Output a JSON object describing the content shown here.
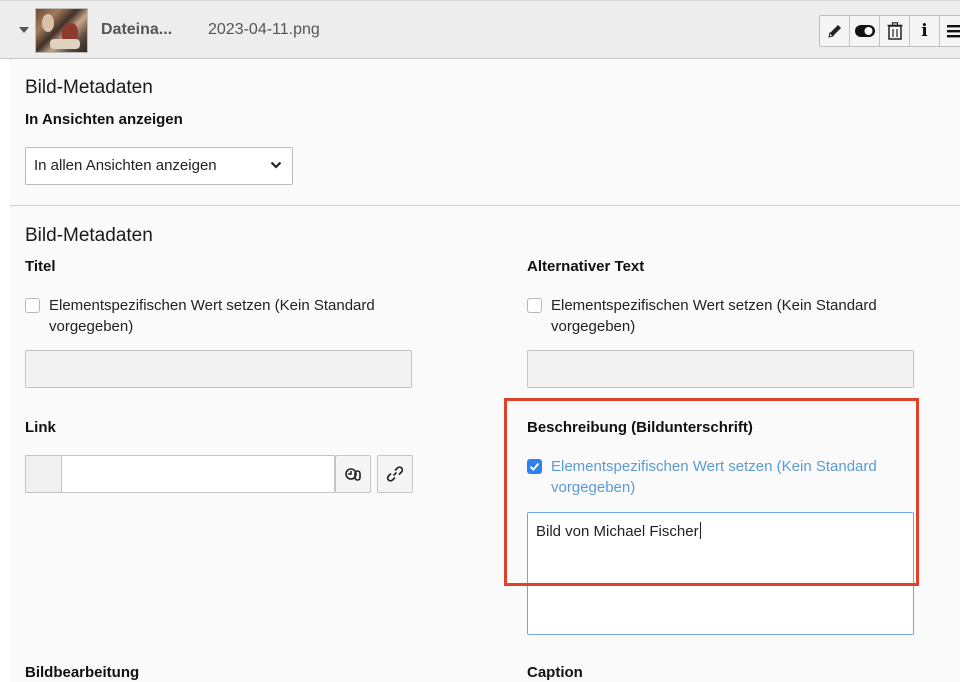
{
  "header": {
    "file_title": "Dateina...",
    "file_name": "2023-04-11.png",
    "toolbar_icons": [
      "pencil-icon",
      "toggle-icon",
      "trash-icon",
      "info-icon",
      "menu-icon"
    ],
    "toolbar_info_glyph": "i"
  },
  "section1": {
    "title": "Bild-Metadaten",
    "visibility_label": "In Ansichten anzeigen",
    "visibility_value": "In allen Ansichten anzeigen"
  },
  "section2": {
    "title": "Bild-Metadaten",
    "titel": {
      "label": "Titel",
      "checkbox_text": "Elementspezifischen Wert setzen (Kein Standard vorgegeben)",
      "checked": false
    },
    "alt_text": {
      "label": "Alternativer Text",
      "checkbox_text": "Elementspezifischen Wert setzen (Kein Standard vorgegeben)",
      "checked": false
    },
    "link": {
      "label": "Link"
    },
    "beschreibung": {
      "label": "Beschreibung (Bildunterschrift)",
      "checkbox_text": "Elementspezifischen Wert setzen (Kein Standard vorgegeben)",
      "checked": true,
      "value": "Bild von Michael Fischer"
    },
    "bildbearbeitung_label": "Bildbearbeitung",
    "caption_label": "Caption"
  },
  "colors": {
    "highlight": "#e3402b",
    "accent": "#2f80ed",
    "active_text": "#5b9bd5"
  }
}
